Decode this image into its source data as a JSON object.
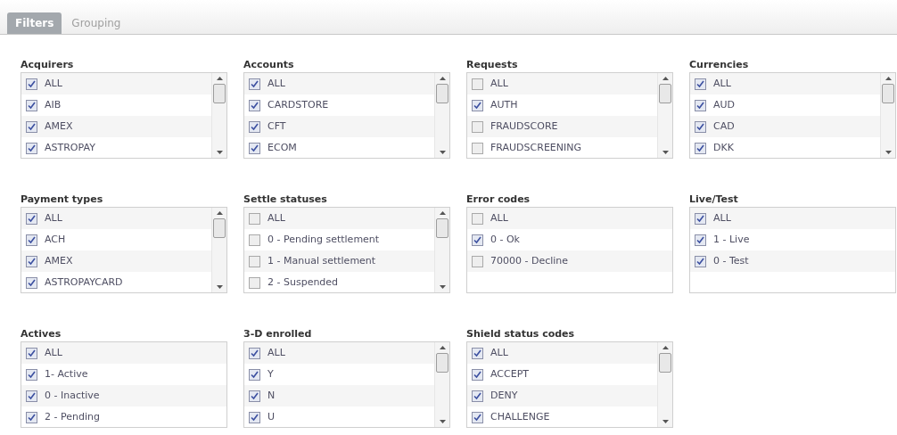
{
  "tabs": [
    {
      "label": "Filters",
      "selected": true
    },
    {
      "label": "Grouping",
      "selected": false
    }
  ],
  "filter_groups": [
    {
      "title": "Acquirers",
      "scrollable": true,
      "items": [
        {
          "label": "ALL",
          "checked": true
        },
        {
          "label": "AIB",
          "checked": true
        },
        {
          "label": "AMEX",
          "checked": true
        },
        {
          "label": "ASTROPAY",
          "checked": true
        }
      ]
    },
    {
      "title": "Accounts",
      "scrollable": true,
      "items": [
        {
          "label": "ALL",
          "checked": true
        },
        {
          "label": "CARDSTORE",
          "checked": true
        },
        {
          "label": "CFT",
          "checked": true
        },
        {
          "label": "ECOM",
          "checked": true
        }
      ]
    },
    {
      "title": "Requests",
      "scrollable": true,
      "items": [
        {
          "label": "ALL",
          "checked": false
        },
        {
          "label": "AUTH",
          "checked": true
        },
        {
          "label": "FRAUDSCORE",
          "checked": false
        },
        {
          "label": "FRAUDSCREENING",
          "checked": false
        }
      ]
    },
    {
      "title": "Currencies",
      "scrollable": true,
      "items": [
        {
          "label": "ALL",
          "checked": true
        },
        {
          "label": "AUD",
          "checked": true
        },
        {
          "label": "CAD",
          "checked": true
        },
        {
          "label": "DKK",
          "checked": true
        }
      ]
    },
    {
      "title": "Payment types",
      "scrollable": true,
      "items": [
        {
          "label": "ALL",
          "checked": true
        },
        {
          "label": "ACH",
          "checked": true
        },
        {
          "label": "AMEX",
          "checked": true
        },
        {
          "label": "ASTROPAYCARD",
          "checked": true
        }
      ]
    },
    {
      "title": "Settle statuses",
      "scrollable": true,
      "items": [
        {
          "label": "ALL",
          "checked": false
        },
        {
          "label": "0 - Pending settlement",
          "checked": false
        },
        {
          "label": "1 - Manual settlement",
          "checked": false
        },
        {
          "label": "2 - Suspended",
          "checked": false
        }
      ]
    },
    {
      "title": "Error codes",
      "scrollable": false,
      "items": [
        {
          "label": "ALL",
          "checked": false
        },
        {
          "label": "0 - Ok",
          "checked": true
        },
        {
          "label": "70000 - Decline",
          "checked": false
        }
      ]
    },
    {
      "title": "Live/Test",
      "scrollable": false,
      "items": [
        {
          "label": "ALL",
          "checked": true
        },
        {
          "label": "1 - Live",
          "checked": true
        },
        {
          "label": "0 - Test",
          "checked": true
        }
      ]
    },
    {
      "title": "Actives",
      "scrollable": false,
      "items": [
        {
          "label": "ALL",
          "checked": true
        },
        {
          "label": "1- Active",
          "checked": true
        },
        {
          "label": "0 - Inactive",
          "checked": true
        },
        {
          "label": "2 - Pending",
          "checked": true
        }
      ]
    },
    {
      "title": "3-D enrolled",
      "scrollable": true,
      "items": [
        {
          "label": "ALL",
          "checked": true
        },
        {
          "label": "Y",
          "checked": true
        },
        {
          "label": "N",
          "checked": true
        },
        {
          "label": "U",
          "checked": true
        }
      ]
    },
    {
      "title": "Shield status codes",
      "scrollable": true,
      "items": [
        {
          "label": "ALL",
          "checked": true
        },
        {
          "label": "ACCEPT",
          "checked": true
        },
        {
          "label": "DENY",
          "checked": true
        },
        {
          "label": "CHALLENGE",
          "checked": true
        }
      ]
    }
  ]
}
